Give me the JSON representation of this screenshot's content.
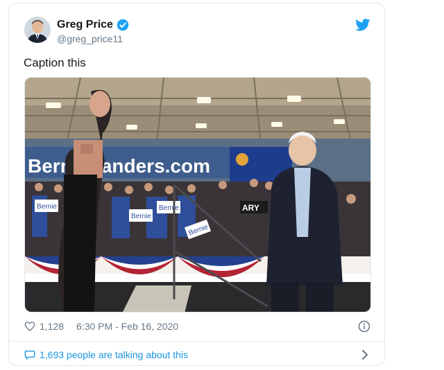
{
  "user": {
    "display_name": "Greg Price",
    "handle": "@greg_price11",
    "verified": true
  },
  "tweet": {
    "text": "Caption this",
    "likes": "1,128",
    "timestamp": "6:30 PM - Feb 16, 2020"
  },
  "photo": {
    "banner_text": "BernieSanders.com",
    "signs": [
      "Bernie",
      "Bernie",
      "Bernie",
      "Bernie"
    ],
    "partial_sign": "ARY"
  },
  "conversation": {
    "label": "1,693 people are talking about this"
  },
  "icons": {
    "verified": "verified-badge-icon",
    "twitter": "twitter-bird-icon",
    "like": "heart-icon",
    "info": "info-icon",
    "reply": "chat-bubble-icon",
    "chevron": "chevron-right-icon"
  },
  "colors": {
    "twitter_blue": "#1da1f2",
    "link_blue": "#1b95e0",
    "secondary_text": "#657786",
    "border": "#e1e8ed"
  }
}
